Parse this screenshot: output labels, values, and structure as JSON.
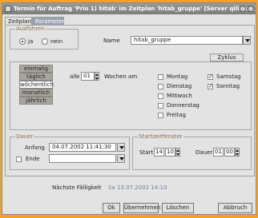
{
  "window": {
    "title": "Termin für Auftrag 'Prio 1) hitab' im Zeitplan 'hitab_gruppe' [Server qilinux1]"
  },
  "tabs": [
    "Zeitplan",
    "Parameter"
  ],
  "ausfuehren": {
    "group_label": "Ausführen",
    "ja_label": "ja",
    "nein_label": "nein",
    "selected": "ja"
  },
  "name": {
    "label": "Name",
    "value": "hitab_gruppe"
  },
  "zyklus": {
    "label": "Zyklus",
    "frequencies": [
      "einmalig",
      "täglich",
      "wöchentlich",
      "monatlich",
      "jährlich"
    ],
    "selected_frequency": "wöchentlich",
    "alle_label": "alle",
    "alle_value": "01",
    "wochen_am_label": "Wochen am",
    "days_col1": [
      {
        "label": "Montag",
        "checked": false
      },
      {
        "label": "Dienstag",
        "checked": false
      },
      {
        "label": "Mittwoch",
        "checked": false
      },
      {
        "label": "Donnerstag",
        "checked": false
      },
      {
        "label": "Freitag",
        "checked": false
      }
    ],
    "days_col2": [
      {
        "label": "Samstag",
        "checked": true
      },
      {
        "label": "Sonntag",
        "checked": true
      }
    ]
  },
  "dauer": {
    "group_label": "Dauer",
    "anfang_label": "Anfang",
    "anfang_value": "04.07.2002 11:41:30",
    "ende_label": "Ende",
    "ende_value": "",
    "ende_checked": false
  },
  "startzeitfenster": {
    "group_label": "Startzeitfenster",
    "start_label": "Start",
    "start_hour": "14",
    "start_min": "10",
    "dauer_label": "Dauer",
    "dauer_hour": "01",
    "dauer_min": "00"
  },
  "status": {
    "label": "Nächste Fälligkeit",
    "value": "Sa 13.07.2002 14:10"
  },
  "buttons": {
    "ok": "Ok",
    "apply": "Übernehmen",
    "delete": "Löschen",
    "cancel": "Abbruch"
  },
  "colors": {
    "background": "#f2a030",
    "titlebar": "#8a8a8a",
    "inactive_tab": "#9aa3b5"
  }
}
